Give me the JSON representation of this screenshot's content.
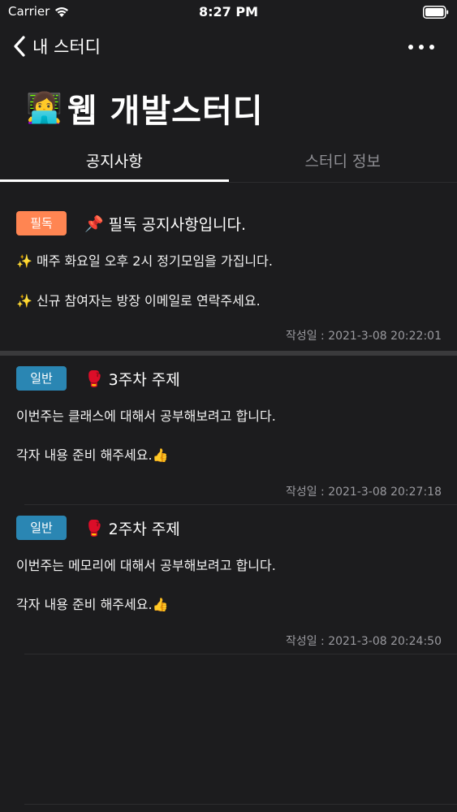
{
  "status_bar": {
    "carrier": "Carrier",
    "time": "8:27 PM"
  },
  "nav": {
    "back_label": "내 스터디"
  },
  "page": {
    "title_emoji": "👩‍💻",
    "title": "웹 개발스터디"
  },
  "tabs": [
    {
      "label": "공지사항",
      "active": true
    },
    {
      "label": "스터디 정보",
      "active": false
    }
  ],
  "notices": [
    {
      "badge": "필독",
      "title_icon": "📌",
      "title": "필독 공지사항입니다.",
      "lines": [
        "✨ 매주 화요일 오후 2시 정기모임을 가집니다.",
        "✨ 신규 참여자는 방장 이메일로 연락주세요."
      ],
      "date": "작성일 : 2021-3-08 20:22:01"
    },
    {
      "badge": "일반",
      "title_icon": "🥊",
      "title": "3주차 주제",
      "lines": [
        "이번주는 클래스에 대해서 공부해보려고 합니다.",
        "각자 내용 준비 해주세요.👍"
      ],
      "date": "작성일 : 2021-3-08 20:27:18"
    },
    {
      "badge": "일반",
      "title_icon": "🥊",
      "title": "2주차 주제",
      "lines": [
        "이번주는 메모리에 대해서 공부해보려고 합니다.",
        "각자 내용 준비 해주세요.👍"
      ],
      "date": "작성일 : 2021-3-08 20:24:50"
    }
  ],
  "colors": {
    "background": "#1c1c1e",
    "pinned_badge": "#ff8552",
    "general_badge": "#2a86b3",
    "meta_text": "#9a9a9f"
  }
}
